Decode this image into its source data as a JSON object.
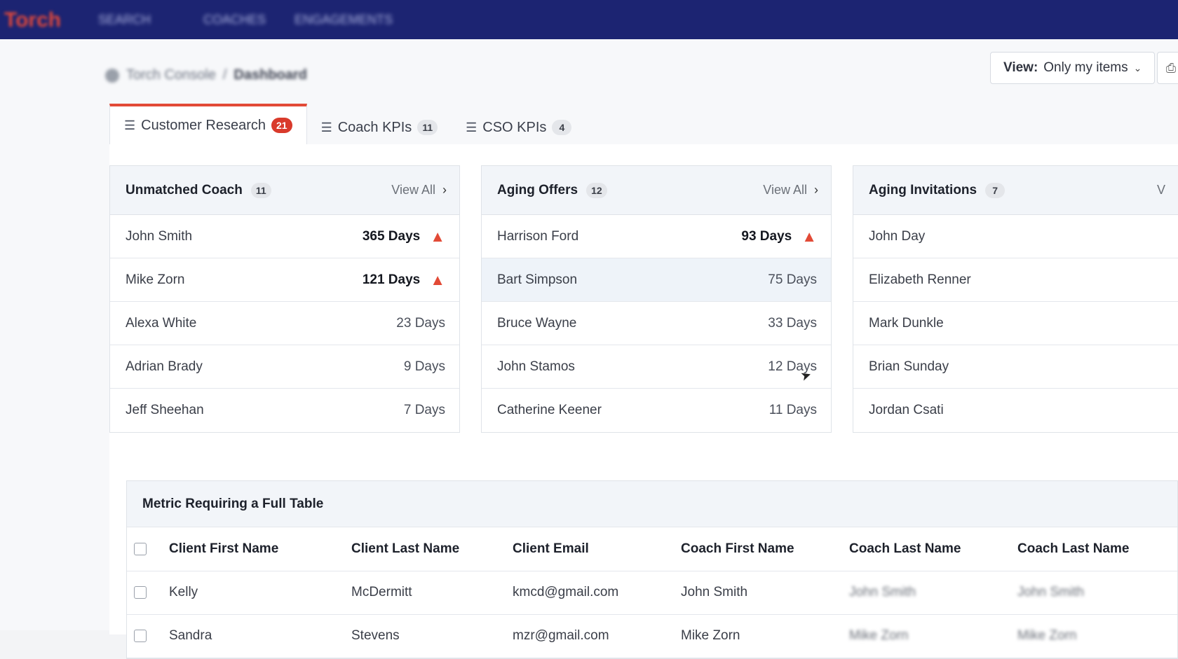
{
  "topbar": {
    "brand": "Torch",
    "nav": [
      "SEARCH",
      "COACHES",
      "ENGAGEMENTS"
    ]
  },
  "breadcrumb": {
    "root": "Torch Console",
    "separator": "/",
    "current": "Dashboard"
  },
  "view_select": {
    "label": "View:",
    "value": "Only my items"
  },
  "tabs": [
    {
      "label": "Customer Research",
      "count": "21",
      "active": true
    },
    {
      "label": "Coach KPIs",
      "count": "11",
      "active": false
    },
    {
      "label": "CSO KPIs",
      "count": "4",
      "active": false
    }
  ],
  "cards": {
    "unmatched_coach": {
      "title": "Unmatched Coach",
      "count": "11",
      "view_all": "View All",
      "rows": [
        {
          "name": "John Smith",
          "days": "365 Days",
          "urgent": true
        },
        {
          "name": "Mike Zorn",
          "days": "121 Days",
          "urgent": true
        },
        {
          "name": "Alexa White",
          "days": "23 Days",
          "urgent": false
        },
        {
          "name": "Adrian Brady",
          "days": "9 Days",
          "urgent": false
        },
        {
          "name": "Jeff Sheehan",
          "days": "7 Days",
          "urgent": false
        }
      ]
    },
    "aging_offers": {
      "title": "Aging Offers",
      "count": "12",
      "view_all": "View All",
      "rows": [
        {
          "name": "Harrison Ford",
          "days": "93 Days",
          "urgent": true
        },
        {
          "name": "Bart Simpson",
          "days": "75 Days",
          "urgent": false
        },
        {
          "name": "Bruce Wayne",
          "days": "33 Days",
          "urgent": false
        },
        {
          "name": "John Stamos",
          "days": "12 Days",
          "urgent": false
        },
        {
          "name": "Catherine Keener",
          "days": "11 Days",
          "urgent": false
        }
      ]
    },
    "aging_invitations": {
      "title": "Aging Invitations",
      "count": "7",
      "view_all": "V",
      "rows": [
        {
          "name": "John Day"
        },
        {
          "name": "Elizabeth Renner"
        },
        {
          "name": "Mark Dunkle"
        },
        {
          "name": "Brian Sunday"
        },
        {
          "name": "Jordan Csati"
        }
      ]
    }
  },
  "full_table": {
    "title": "Metric Requiring a Full Table",
    "columns": [
      "Client First Name",
      "Client Last Name",
      "Client Email",
      "Coach First Name",
      "Coach Last Name",
      "Coach Last Name"
    ],
    "rows": [
      [
        "Kelly",
        "McDermitt",
        "kmcd@gmail.com",
        "John Smith",
        "John Smith",
        "John Smith"
      ],
      [
        "Sandra",
        "Stevens",
        "mzr@gmail.com",
        "Mike Zorn",
        "Mike Zorn",
        "Mike Zorn"
      ]
    ]
  },
  "colors": {
    "topbar": "#1c2472",
    "accent": "#e24a36",
    "badge_red": "#d93a2b",
    "header_bg": "#f2f5f9"
  }
}
